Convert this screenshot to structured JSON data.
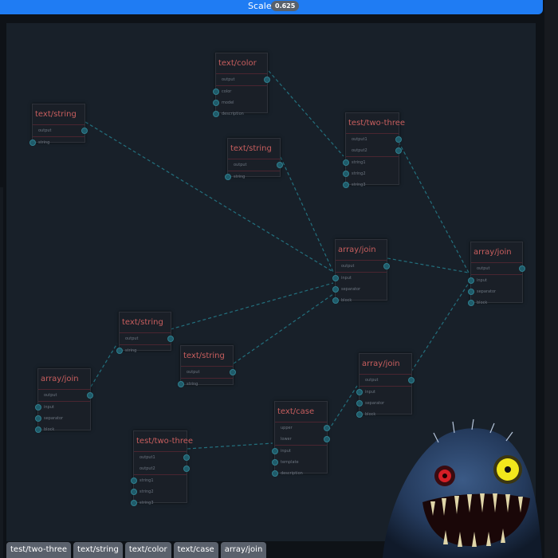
{
  "toolbar": {
    "scale_label": "Scale",
    "scale_value": "0.625"
  },
  "nodes": [
    {
      "id": "n1",
      "title": "text/color",
      "outputs": [
        "output"
      ],
      "inputs": [
        "color",
        "model",
        "description"
      ]
    },
    {
      "id": "n2",
      "title": "text/string",
      "outputs": [
        "output"
      ],
      "inputs": [
        "string"
      ]
    },
    {
      "id": "n3",
      "title": "test/two-three",
      "outputs": [
        "output1",
        "output2"
      ],
      "inputs": [
        "string1",
        "string2",
        "string3"
      ]
    },
    {
      "id": "n4",
      "title": "text/string",
      "outputs": [
        "output"
      ],
      "inputs": [
        "string"
      ]
    },
    {
      "id": "n5",
      "title": "array/join",
      "outputs": [
        "output"
      ],
      "inputs": [
        "input",
        "separator",
        "block"
      ]
    },
    {
      "id": "n6",
      "title": "array/join",
      "outputs": [
        "output"
      ],
      "inputs": [
        "input",
        "separator",
        "block"
      ]
    },
    {
      "id": "n7",
      "title": "text/string",
      "outputs": [
        "output"
      ],
      "inputs": [
        "string"
      ]
    },
    {
      "id": "n8",
      "title": "text/string",
      "outputs": [
        "output"
      ],
      "inputs": [
        "string"
      ]
    },
    {
      "id": "n9",
      "title": "array/join",
      "outputs": [
        "output"
      ],
      "inputs": [
        "input",
        "separator",
        "block"
      ]
    },
    {
      "id": "n10",
      "title": "array/join",
      "outputs": [
        "output"
      ],
      "inputs": [
        "input",
        "separator",
        "block"
      ]
    },
    {
      "id": "n11",
      "title": "text/case",
      "outputs": [
        "upper",
        "lower"
      ],
      "inputs": [
        "input",
        "template",
        "description"
      ]
    },
    {
      "id": "n12",
      "title": "test/two-three",
      "outputs": [
        "output1",
        "output2"
      ],
      "inputs": [
        "string1",
        "string2",
        "string3"
      ]
    }
  ],
  "tabs": [
    "test/two-three",
    "text/string",
    "text/color",
    "text/case",
    "array/join"
  ],
  "colors": {
    "accent": "#1f7cf3",
    "node_title": "#c85e5e",
    "wire": "#23707e",
    "port": "#2f7f8e"
  }
}
